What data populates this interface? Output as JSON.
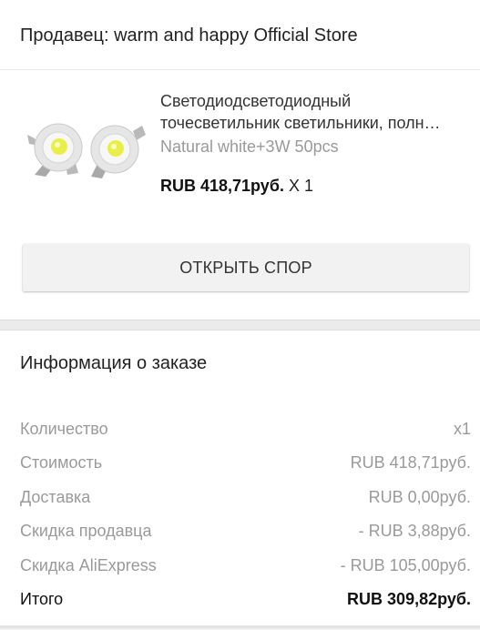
{
  "seller": {
    "title": "Продавец: warm and happy Official Store"
  },
  "product": {
    "name_line1": "Светодиодсветодиодный",
    "name_line2": "точесветильник светильники, полн…",
    "variant": "Natural white+3W 50pcs",
    "price": "RUB 418,71руб.",
    "quantity": "X 1"
  },
  "actions": {
    "dispute_label": "ОТКРЫТЬ СПОР"
  },
  "order": {
    "title": "Информация о заказе",
    "rows": [
      {
        "label": "Количество",
        "value": "x1"
      },
      {
        "label": "Стоимость",
        "value": "RUB 418,71руб."
      },
      {
        "label": "Доставка",
        "value": "RUB 0,00руб."
      },
      {
        "label": "Скидка продавца",
        "value": "- RUB 3,88руб."
      },
      {
        "label": "Скидка AliExpress",
        "value": "- RUB 105,00руб."
      },
      {
        "label": "Итого",
        "value": "RUB 309,82руб."
      }
    ]
  }
}
